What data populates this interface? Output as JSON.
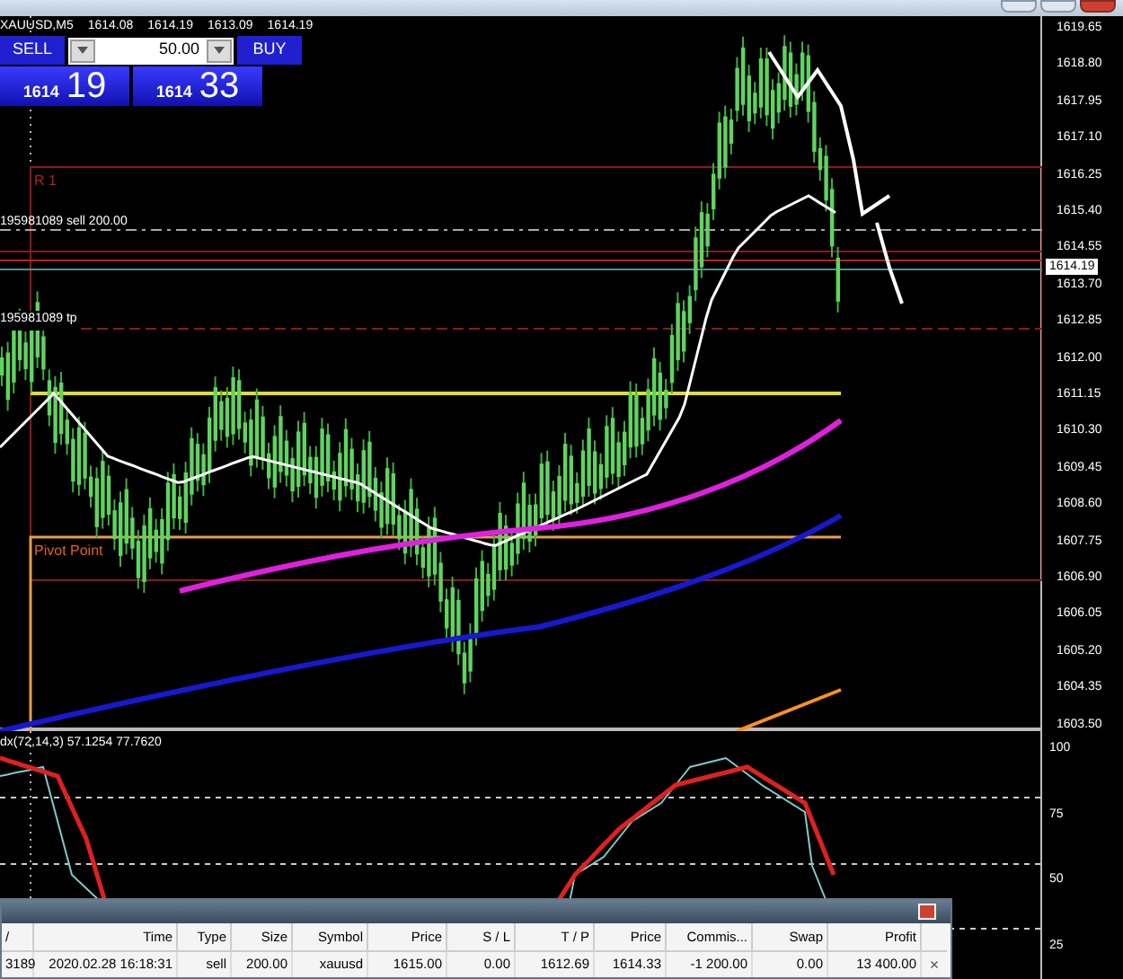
{
  "symbol_line": [
    "XAUUSD,M5",
    "1614.08",
    "1614.19",
    "1613.09",
    "1614.19"
  ],
  "one_click": {
    "sell_label": "SELL",
    "lot": "50.00",
    "buy_label": "BUY",
    "bid": {
      "small": "1614",
      "big": "19"
    },
    "ask": {
      "small": "1614",
      "big": "33"
    }
  },
  "chart_labels": {
    "r1": "R 1",
    "pivot": "Pivot Point",
    "order_sell": "195981089 sell 200.00",
    "order_tp": "195981089 tp"
  },
  "price_axis": [
    "1619.65",
    "1618.80",
    "1617.95",
    "1617.10",
    "1616.25",
    "1615.40",
    "1614.55",
    "1613.70",
    "1612.85",
    "1612.00",
    "1611.15",
    "1610.30",
    "1609.45",
    "1608.60",
    "1607.75",
    "1606.90",
    "1606.05",
    "1605.20",
    "1604.35",
    "1603.50"
  ],
  "current_price": "1614.19",
  "indicator": {
    "label": "dx(72,14,3) 57.1254 77.7620",
    "axis": [
      "100",
      "75",
      "50",
      "25"
    ]
  },
  "trade_panel": {
    "columns": [
      "/",
      "Time",
      "Type",
      "Size",
      "Symbol",
      "Price",
      "S / L",
      "T / P",
      "Price",
      "Commis...",
      "Swap",
      "Profit"
    ],
    "rows": [
      {
        "cells": [
          "3189",
          "2020.02.28 16:18:31",
          "sell",
          "200.00",
          "xauusd",
          "1615.00",
          "0.00",
          "1612.69",
          "1614.33",
          "-1 200.00",
          "0.00",
          "13 400.00"
        ],
        "close": "×"
      }
    ]
  }
}
